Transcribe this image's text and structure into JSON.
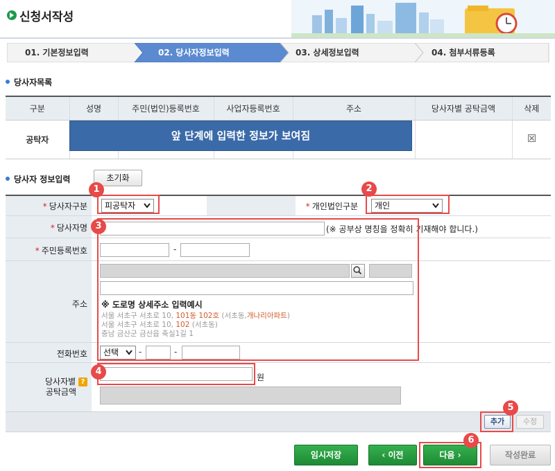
{
  "header": {
    "title": "신청서작성"
  },
  "steps": [
    {
      "label": "01. 기본정보입력",
      "active": false
    },
    {
      "label": "02. 당사자정보입력",
      "active": true
    },
    {
      "label": "03. 상세정보입력",
      "active": false
    },
    {
      "label": "04. 첨부서류등록",
      "active": false
    }
  ],
  "party_list": {
    "section_title": "당사자목록",
    "columns": [
      "구분",
      "성명",
      "주민(법인)등록번호",
      "사업자등록번호",
      "주소",
      "당사자별 공탁금액",
      "삭제"
    ],
    "row": {
      "type": "공탁자",
      "banner": "앞 단계에 입력한 정보가 보여짐"
    }
  },
  "party_input": {
    "section_title": "당사자 정보입력",
    "reset_label": "초기화",
    "party_type_label": "당사자구분",
    "party_type_value": "피공탁자",
    "person_corp_label": "개인법인구분",
    "person_corp_value": "개인",
    "name_label": "당사자명",
    "name_note": "(※ 공부상 명칭을 정확히 기재해야 합니다.)",
    "rrn_label": "주민등록번호",
    "address_label": "주소",
    "address_example_title": "※ 도로명 상세주소 입력예시",
    "address_examples": [
      {
        "pre": "서울 서초구 서초로 10, ",
        "hl": "101동 102호",
        "mid": " (서초동,",
        "hl2": "개나리아파트",
        "post": ")"
      },
      {
        "pre": "서울 서초구 서초로 10, ",
        "hl": "102",
        "mid": " (서초동)",
        "hl2": "",
        "post": ""
      },
      {
        "pre": "충남 금산군 금산읍 축실1길 1",
        "hl": "",
        "mid": "",
        "hl2": "",
        "post": ""
      }
    ],
    "phone_label": "전화번호",
    "phone_select": "선택",
    "amount_label_line1": "당사자별",
    "amount_label_line2": "공탁금액",
    "help_glyph": "?",
    "amount_unit": "원",
    "dash": "-"
  },
  "row_buttons": {
    "add": "추가",
    "edit": "수정"
  },
  "footer_buttons": {
    "temp_save": "임시저장",
    "prev": "‹  이전",
    "next": "다음  ›",
    "done": "작성완료"
  },
  "annotations": [
    "1",
    "2",
    "3",
    "4",
    "5",
    "6"
  ],
  "colors": {
    "accent_green": "#1e8a35",
    "annotation_red": "#e84949",
    "banner_blue": "#3a6aa8",
    "active_step": "#5b8ad0"
  }
}
